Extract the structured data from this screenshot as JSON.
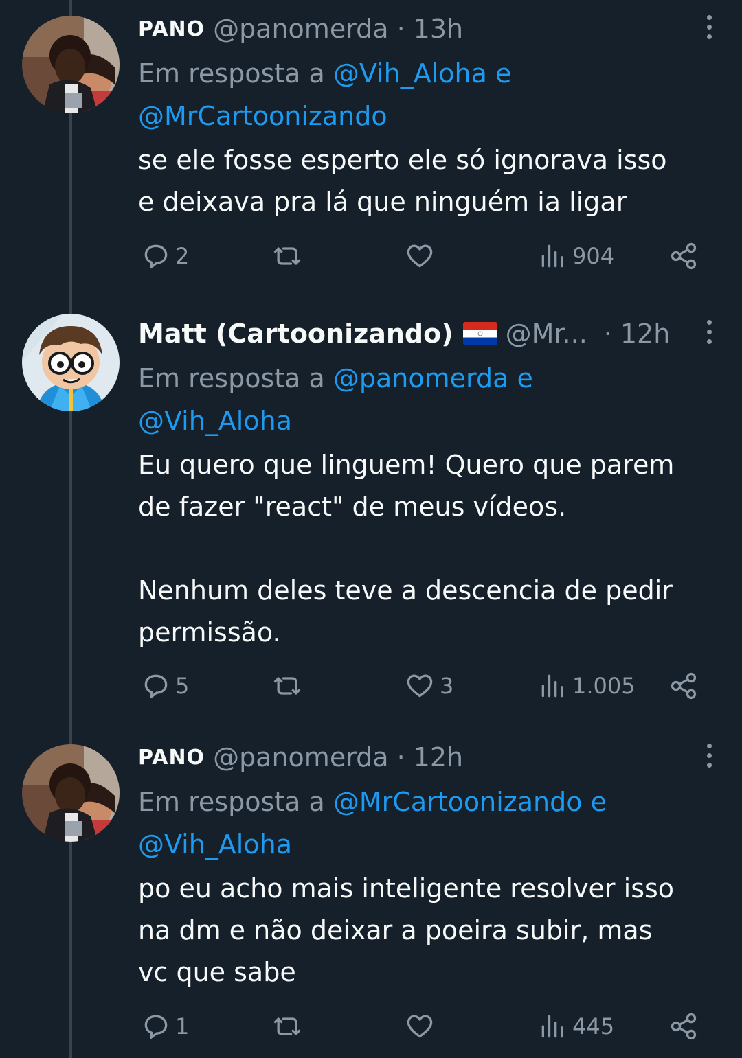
{
  "tweets": [
    {
      "name": "PANO",
      "handle": "@panomerda",
      "dot": "·",
      "time": "13h",
      "reply_prefix": "Em resposta a",
      "reply_mention_1": "@Vih_Aloha e",
      "reply_mention_2": "@MrCartoonizando",
      "text": "se ele fosse esperto ele só ignorava isso\ne deixava pra lá que ninguém ia ligar",
      "replies": "2",
      "retweets": "",
      "likes": "",
      "views": "904",
      "avatar_icon": "profile-photo"
    },
    {
      "name": "Matt (Cartoonizando)",
      "handle": "@Mr...",
      "dot": "·",
      "time": "12h",
      "reply_prefix": "Em resposta a",
      "reply_mention_1": "@panomerda e",
      "reply_mention_2": "@Vih_Aloha",
      "text": "Eu quero que linguem! Quero que parem\nde fazer \"react\" de meus vídeos.\n\nNenhum deles teve a descencia de pedir\npermissão.",
      "replies": "5",
      "retweets": "",
      "likes": "3",
      "views": "1.005",
      "avatar_icon": "cartoon-avatar",
      "flag_icon": "paraguay-flag"
    },
    {
      "name": "PANO",
      "handle": "@panomerda",
      "dot": "·",
      "time": "12h",
      "reply_prefix": "Em resposta a",
      "reply_mention_1": "@MrCartoonizando e",
      "reply_mention_2": "@Vih_Aloha",
      "text": "po eu acho mais inteligente resolver isso\nna dm e não deixar a poeira subir, mas\nvc que sabe",
      "replies": "1",
      "retweets": "",
      "likes": "",
      "views": "445",
      "avatar_icon": "profile-photo"
    }
  ],
  "icons": {
    "reply": "reply-icon",
    "retweet": "retweet-icon",
    "like": "like-icon",
    "views": "views-icon",
    "share": "share-icon",
    "more": "more-icon"
  },
  "colors": {
    "background": "#15202b",
    "text": "#f7f9f9",
    "secondary": "#8b98a5",
    "mention": "#1d9bf0",
    "thread_line": "#38444d"
  }
}
